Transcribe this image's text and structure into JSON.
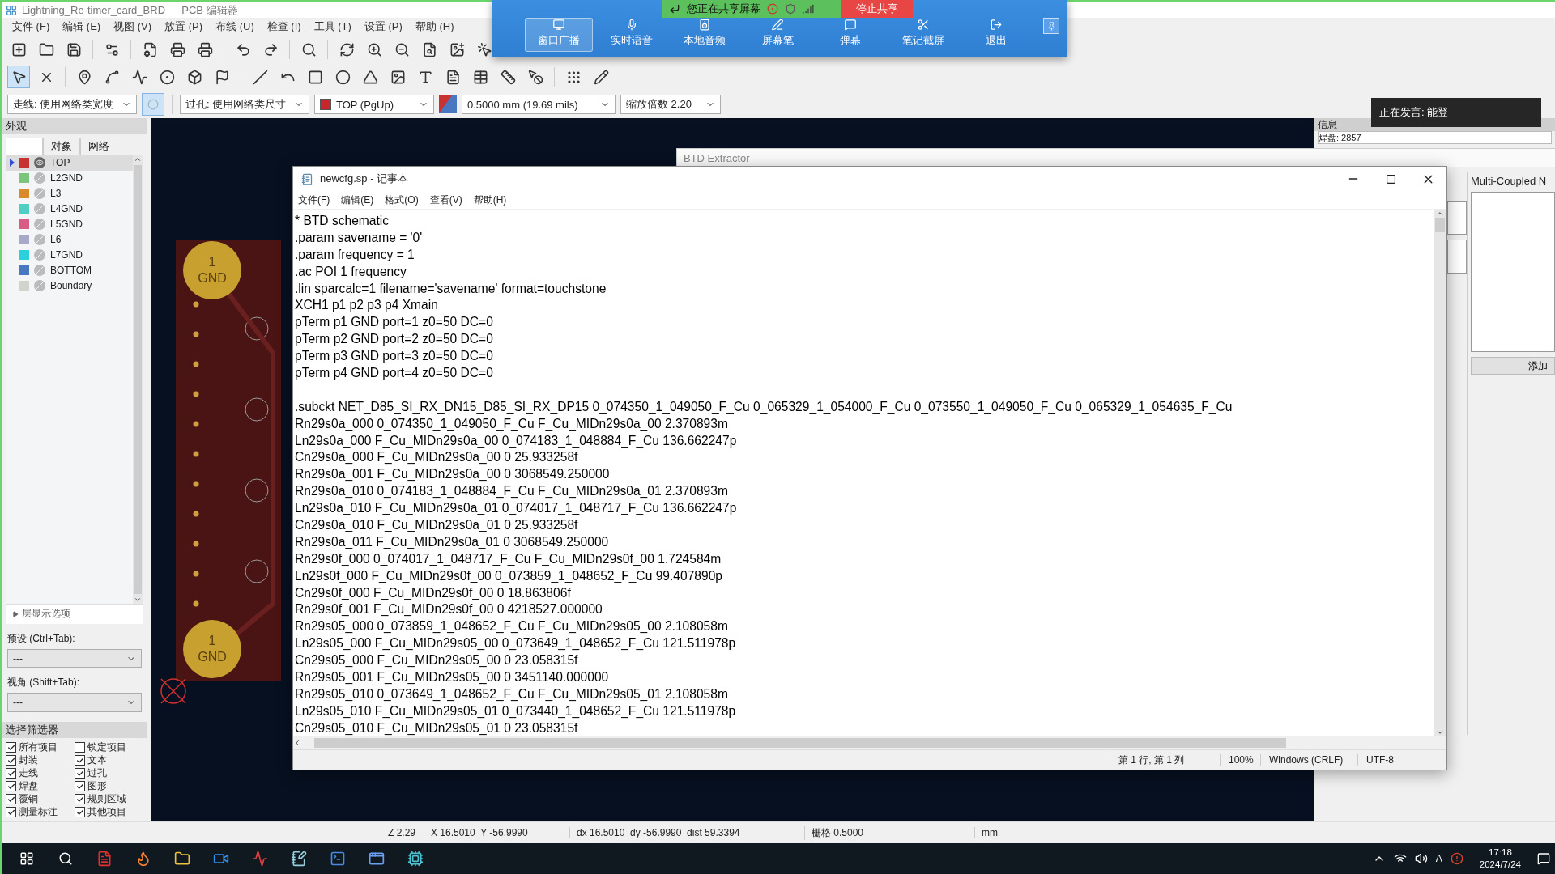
{
  "window": {
    "title": "Lightning_Re-timer_card_BRD — PCB 编辑器"
  },
  "menu": [
    "文件 (F)",
    "编辑 (E)",
    "视图 (V)",
    "放置 (P)",
    "布线 (U)",
    "检查 (I)",
    "工具 (T)",
    "设置 (P)",
    "帮助 (H)"
  ],
  "toolbar": {
    "track_width": "走线: 使用网络类宽度",
    "via_size": "过孔: 使用网络类尺寸",
    "layer": {
      "label": "TOP (PgUp)",
      "color": "#c8262a"
    },
    "grid": "0.5000 mm (19.69 mils)",
    "zoom": "缩放倍数 2.20"
  },
  "appearance": {
    "title": "外观",
    "tabs": [
      {
        "selected": true
      },
      {
        "label": "对象",
        "selected": false
      },
      {
        "label": "网络",
        "selected": false
      }
    ],
    "layers": [
      {
        "name": "TOP",
        "color": "#c83232",
        "visible": true,
        "selected": true
      },
      {
        "name": "L2GND",
        "color": "#7bc67b",
        "visible": false,
        "selected": false
      },
      {
        "name": "L3",
        "color": "#d98a2b",
        "visible": false,
        "selected": false
      },
      {
        "name": "L4GND",
        "color": "#4fcfc4",
        "visible": false,
        "selected": false
      },
      {
        "name": "L5GND",
        "color": "#d95c84",
        "visible": false,
        "selected": false
      },
      {
        "name": "L6",
        "color": "#a8a8c8",
        "visible": false,
        "selected": false
      },
      {
        "name": "L7GND",
        "color": "#2ad0dc",
        "visible": false,
        "selected": false
      },
      {
        "name": "BOTTOM",
        "color": "#4a78c0",
        "visible": false,
        "selected": false
      },
      {
        "name": "Boundary",
        "color": "#d0d4cc",
        "visible": false,
        "selected": false
      }
    ],
    "layer_options": "层显示选项",
    "preset_label": "预设 (Ctrl+Tab):",
    "preset_value": "---",
    "view_label": "视角 (Shift+Tab):",
    "view_value": "---"
  },
  "selection_filter": {
    "title": "选择筛选器",
    "items": [
      {
        "label": "所有项目",
        "checked": true
      },
      {
        "label": "锁定项目",
        "checked": false
      },
      {
        "label": "封装",
        "checked": true
      },
      {
        "label": "文本",
        "checked": true
      },
      {
        "label": "走线",
        "checked": true
      },
      {
        "label": "过孔",
        "checked": true
      },
      {
        "label": "焊盘",
        "checked": true
      },
      {
        "label": "图形",
        "checked": true
      },
      {
        "label": "覆铜",
        "checked": true
      },
      {
        "label": "规则区域",
        "checked": true
      },
      {
        "label": "测量标注",
        "checked": true
      },
      {
        "label": "其他项目",
        "checked": true
      }
    ]
  },
  "board": {
    "pads": [
      {
        "number": "1",
        "net": "GND"
      },
      {
        "number": "1",
        "net": "GND"
      }
    ]
  },
  "info_panel": {
    "title": "信息",
    "row": "焊盘: 2857"
  },
  "btd_extractor": {
    "title": "BTD Extractor",
    "group": "Multi-Coupled N",
    "add_button": "添加"
  },
  "notepad": {
    "title": "newcfg.sp - 记事本",
    "menu": [
      "文件(F)",
      "编辑(E)",
      "格式(O)",
      "查看(V)",
      "帮助(H)"
    ],
    "blocks": [
      [
        "* BTD schematic",
        ".param savename = '0'",
        ".param frequency = 1",
        ".ac POI 1 frequency",
        ".lin sparcalc=1 filename='savename' format=touchstone",
        "XCH1 p1 p2 p3 p4 Xmain",
        "pTerm p1 GND port=1 z0=50 DC=0",
        "pTerm p2 GND port=2 z0=50 DC=0",
        "pTerm p3 GND port=3 z0=50 DC=0",
        "pTerm p4 GND port=4 z0=50 DC=0"
      ],
      [
        ".subckt NET_D85_SI_RX_DN15_D85_SI_RX_DP15 0_074350_1_049050_F_Cu 0_065329_1_054000_F_Cu 0_073550_1_049050_F_Cu 0_065329_1_054635_F_Cu",
        "Rn29s0a_000 0_074350_1_049050_F_Cu F_Cu_MIDn29s0a_00 2.370893m",
        "Ln29s0a_000 F_Cu_MIDn29s0a_00 0_074183_1_048884_F_Cu 136.662247p",
        "Cn29s0a_000 F_Cu_MIDn29s0a_00 0 25.933258f",
        "Rn29s0a_001 F_Cu_MIDn29s0a_00 0 3068549.250000",
        "Rn29s0a_010 0_074183_1_048884_F_Cu F_Cu_MIDn29s0a_01 2.370893m",
        "Ln29s0a_010 F_Cu_MIDn29s0a_01 0_074017_1_048717_F_Cu 136.662247p",
        "Cn29s0a_010 F_Cu_MIDn29s0a_01 0 25.933258f",
        "Rn29s0a_011 F_Cu_MIDn29s0a_01 0 3068549.250000",
        "Rn29s0f_000 0_074017_1_048717_F_Cu F_Cu_MIDn29s0f_00 1.724584m",
        "Ln29s0f_000 F_Cu_MIDn29s0f_00 0_073859_1_048652_F_Cu 99.407890p",
        "Cn29s0f_000 F_Cu_MIDn29s0f_00 0 18.863806f",
        "Rn29s0f_001 F_Cu_MIDn29s0f_00 0 4218527.000000",
        "Rn29s05_000 0_073859_1_048652_F_Cu F_Cu_MIDn29s05_00 2.108058m",
        "Ln29s05_000 F_Cu_MIDn29s05_00 0_073649_1_048652_F_Cu 121.511978p",
        "Cn29s05_000 F_Cu_MIDn29s05_00 0 23.058315f",
        "Rn29s05_001 F_Cu_MIDn29s05_00 0 3451140.000000",
        "Rn29s05_010 0_073649_1_048652_F_Cu F_Cu_MIDn29s05_01 2.108058m",
        "Ln29s05_010 F_Cu_MIDn29s05_01 0_073440_1_048652_F_Cu 121.511978p",
        "Cn29s05_010 F_Cu_MIDn29s05_01 0 23.058315f"
      ]
    ],
    "status": {
      "position": "第 1 行, 第 1 列",
      "zoom": "100%",
      "line_ending": "Windows (CRLF)",
      "encoding": "UTF-8"
    }
  },
  "status_bar": [
    "Z 2.29",
    "X 16.5010  Y -56.9990",
    "dx 16.5010  dy -56.9990  dist 59.3394",
    "栅格 0.5000",
    "mm"
  ],
  "screen_share": {
    "status": "您正在共享屏幕",
    "stop": "停止共享",
    "tools": [
      {
        "label": "窗口广播",
        "selected": true
      },
      {
        "label": "实时语音",
        "selected": false
      },
      {
        "label": "本地音频",
        "selected": false
      },
      {
        "label": "屏幕笔",
        "selected": false
      },
      {
        "label": "弹幕",
        "selected": false
      },
      {
        "label": "笔记截屏",
        "selected": false
      },
      {
        "label": "退出",
        "selected": false
      }
    ]
  },
  "speaker": "正在发言: 能登",
  "taskbar": {
    "ime": "A",
    "time": "17:18",
    "date": "2024/7/24"
  }
}
